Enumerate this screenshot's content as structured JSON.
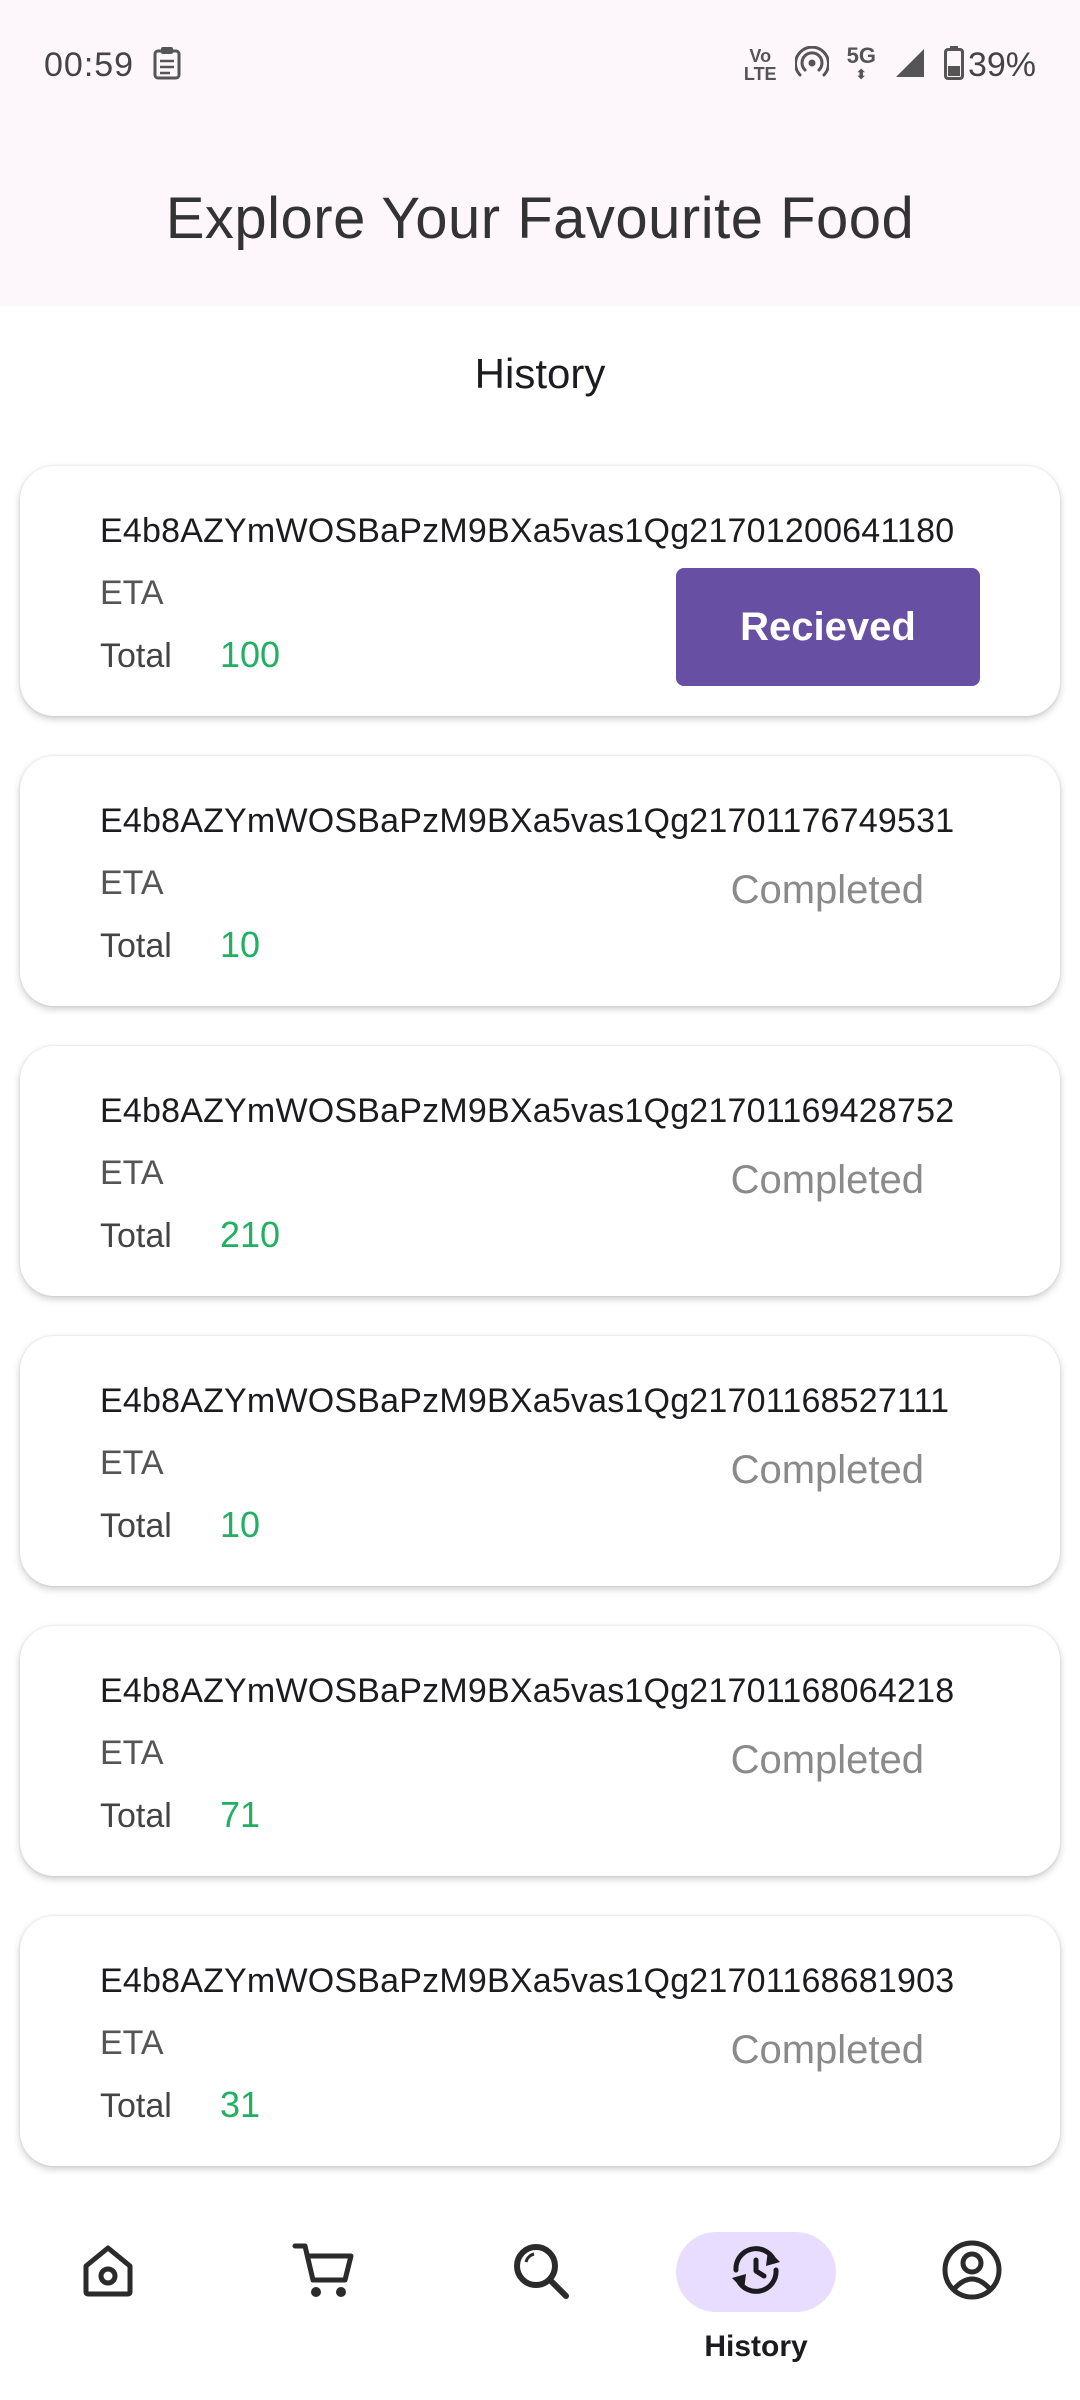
{
  "status_bar": {
    "time": "00:59",
    "volte_top": "Vo",
    "volte_bottom": "LTE",
    "network": "5G",
    "battery": "39%"
  },
  "header": {
    "title": "Explore Your Favourite Food"
  },
  "section": {
    "title": "History"
  },
  "orders": [
    {
      "id": "E4b8AZYmWOSBaPzM9BXa5vas1Qg21701200641180",
      "eta_label": "ETA",
      "total_label": "Total",
      "total": "100",
      "status": "Recieved",
      "status_type": "button"
    },
    {
      "id": "E4b8AZYmWOSBaPzM9BXa5vas1Qg21701176749531",
      "eta_label": "ETA",
      "total_label": "Total",
      "total": "10",
      "status": "Completed",
      "status_type": "text"
    },
    {
      "id": "E4b8AZYmWOSBaPzM9BXa5vas1Qg21701169428752",
      "eta_label": "ETA",
      "total_label": "Total",
      "total": "210",
      "status": "Completed",
      "status_type": "text"
    },
    {
      "id": "E4b8AZYmWOSBaPzM9BXa5vas1Qg21701168527111",
      "eta_label": "ETA",
      "total_label": "Total",
      "total": "10",
      "status": "Completed",
      "status_type": "text"
    },
    {
      "id": "E4b8AZYmWOSBaPzM9BXa5vas1Qg21701168064218",
      "eta_label": "ETA",
      "total_label": "Total",
      "total": "71",
      "status": "Completed",
      "status_type": "text"
    },
    {
      "id": "E4b8AZYmWOSBaPzM9BXa5vas1Qg21701168681903",
      "eta_label": "ETA",
      "total_label": "Total",
      "total": "31",
      "status": "Completed",
      "status_type": "text"
    }
  ],
  "bottom_nav": {
    "items": [
      {
        "icon": "home-icon",
        "label": ""
      },
      {
        "icon": "cart-icon",
        "label": ""
      },
      {
        "icon": "search-icon",
        "label": ""
      },
      {
        "icon": "history-icon",
        "label": "History",
        "active": true
      },
      {
        "icon": "profile-icon",
        "label": ""
      }
    ]
  },
  "colors": {
    "accent": "#6750a4",
    "total_value": "#20b061",
    "active_indicator": "#e9ddff",
    "header_bg": "#fdf7fb"
  }
}
